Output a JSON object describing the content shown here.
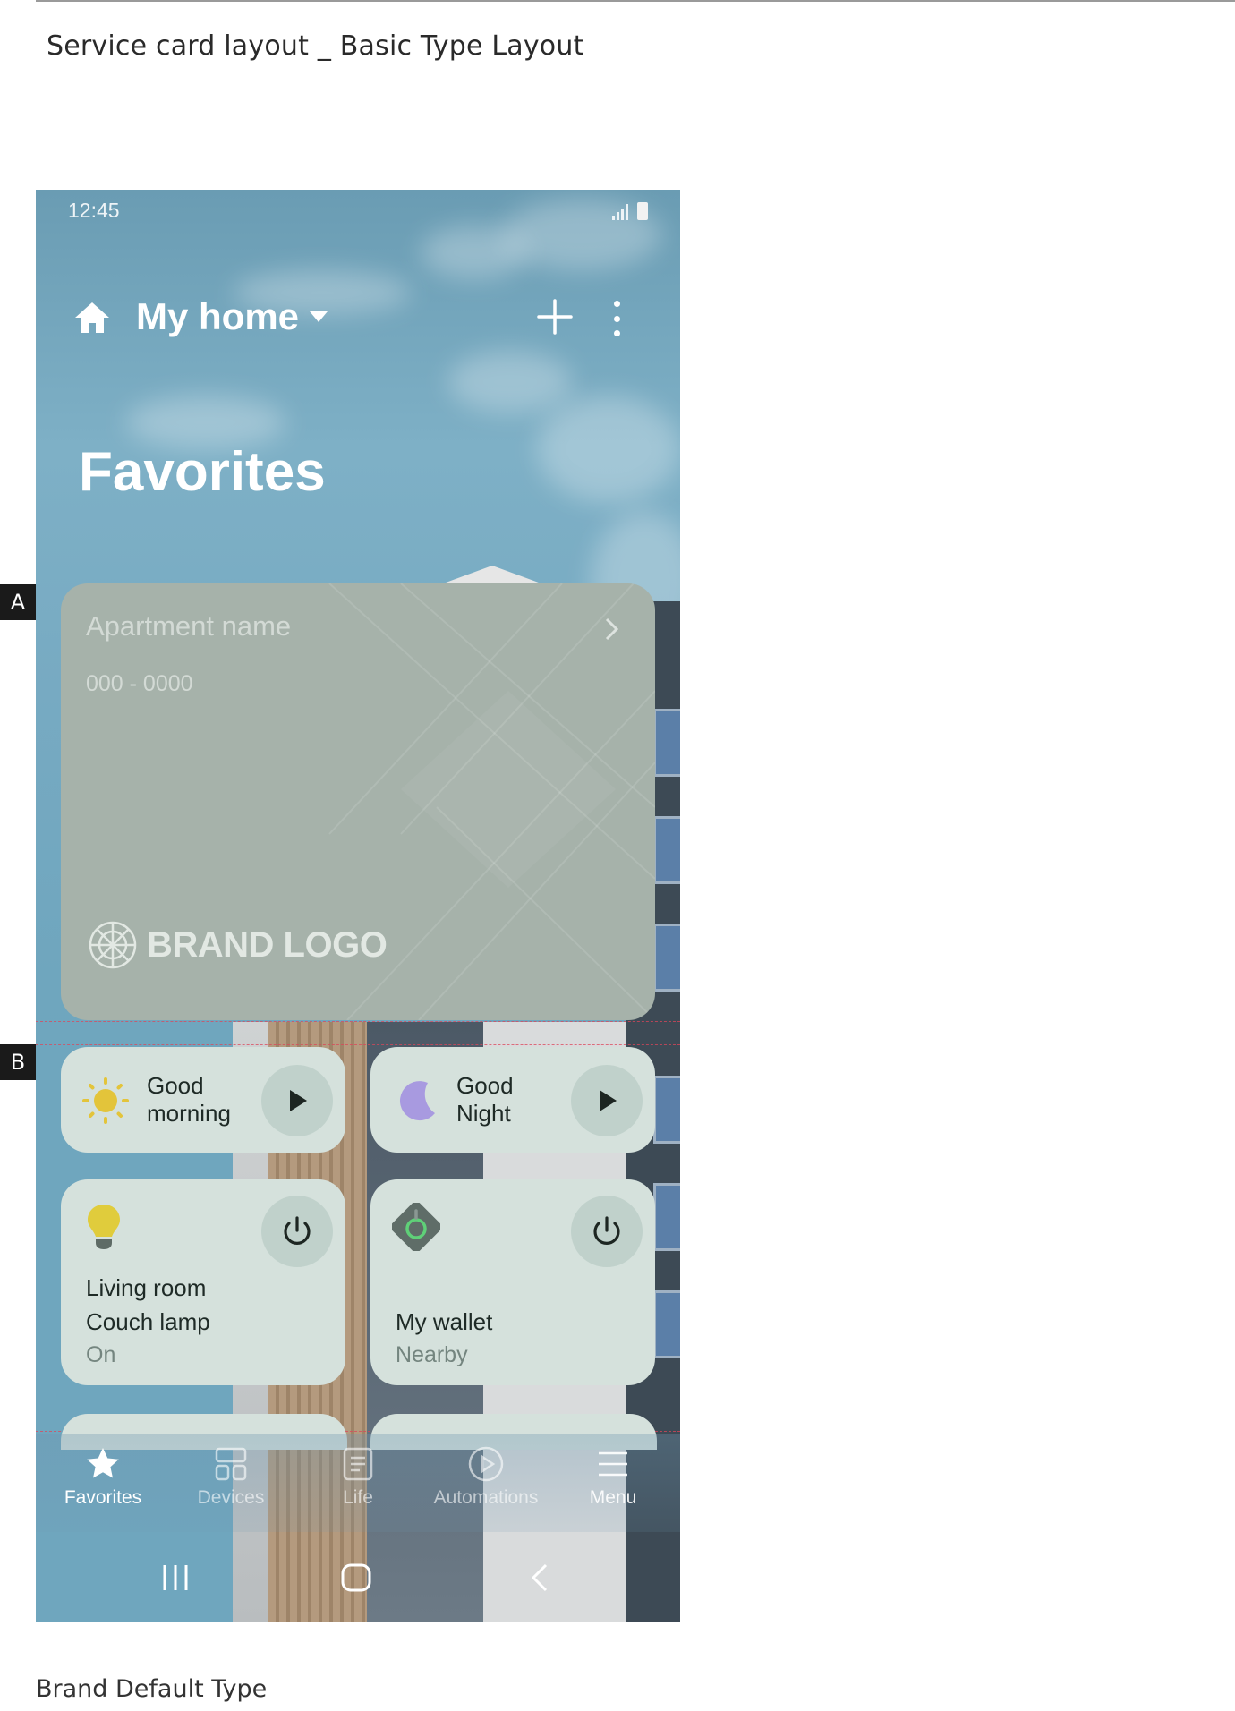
{
  "document": {
    "title": "Service card layout _ Basic Type Layout",
    "caption": "Brand Default Type"
  },
  "markers": {
    "a": "A",
    "b": "B"
  },
  "status_bar": {
    "time": "12:45"
  },
  "header": {
    "home_name": "My home"
  },
  "page": {
    "title": "Favorites"
  },
  "service_card": {
    "name": "Apartment name",
    "number": "000 - 0000",
    "logo_text": "BRAND LOGO"
  },
  "scenes": [
    {
      "line1": "Good",
      "line2": "morning",
      "icon": "sun-icon"
    },
    {
      "line1": "Good",
      "line2": "Night",
      "icon": "moon-icon"
    }
  ],
  "devices": [
    {
      "line1": "Living room",
      "line2": "Couch lamp",
      "status": "On",
      "icon": "bulb-icon"
    },
    {
      "line1": "My wallet",
      "status": "Nearby",
      "icon": "tag-icon"
    }
  ],
  "bottom_nav": [
    {
      "label": "Favorites",
      "icon": "star-icon",
      "active": true
    },
    {
      "label": "Devices",
      "icon": "devices-icon",
      "active": false
    },
    {
      "label": "Life",
      "icon": "life-icon",
      "active": false
    },
    {
      "label": "Automations",
      "icon": "play-circle-icon",
      "active": false
    },
    {
      "label": "Menu",
      "icon": "menu-icon",
      "active": false
    }
  ],
  "colors": {
    "card_bg": "#d5e1dc",
    "service_card_bg": "#a6b2aa",
    "sun": "#e3c43a",
    "moon": "#a89ae0",
    "bulb": "#e0cc3c",
    "tag_ring": "#5fd078"
  }
}
